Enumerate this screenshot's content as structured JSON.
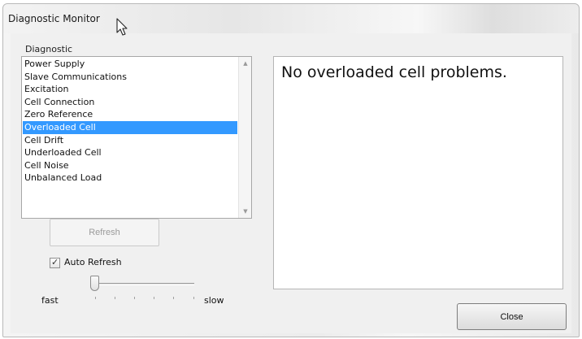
{
  "window": {
    "title": "Diagnostic Monitor"
  },
  "diagnostic": {
    "group_label": "Diagnostic",
    "items": [
      "Power Supply",
      "Slave Communications",
      "Excitation",
      "Cell Connection",
      "Zero Reference",
      "Overloaded Cell",
      "Cell Drift",
      "Underloaded Cell",
      "Cell Noise",
      "Unbalanced Load"
    ],
    "selected": "Overloaded Cell"
  },
  "result": {
    "message": "No overloaded cell problems."
  },
  "controls": {
    "refresh_label": "Refresh",
    "refresh_enabled": false,
    "auto_refresh_label": "Auto Refresh",
    "auto_refresh_checked": true,
    "speed_min_label": "fast",
    "speed_max_label": "slow",
    "speed_level": 0
  },
  "footer": {
    "close_label": "Close"
  },
  "icons": {
    "cursor": "arrow-cursor-icon",
    "scroll_up": "scroll-up-arrow-icon",
    "scroll_down": "scroll-down-arrow-icon",
    "check": "checkmark-icon"
  },
  "colors": {
    "selection": "#3399ff",
    "window_bg": "#f0f0f0"
  }
}
